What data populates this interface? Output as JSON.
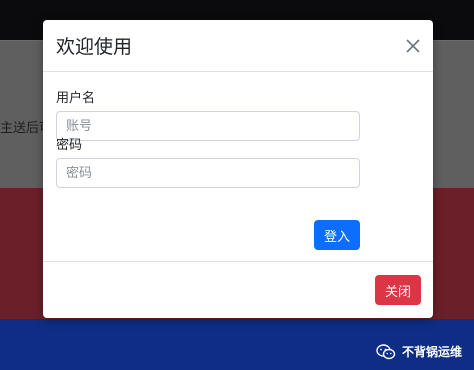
{
  "background": {
    "partial_text": "主送后可",
    "watermark_text": "不背锅运维",
    "watermark_icon": "wechat-icon"
  },
  "modal": {
    "title": "欢迎使用",
    "close_icon": "close-icon",
    "username": {
      "label": "用户名",
      "placeholder": "账号",
      "value": ""
    },
    "password": {
      "label": "密码",
      "placeholder": "密码",
      "value": ""
    },
    "login_button": "登入",
    "close_button": "关闭"
  },
  "colors": {
    "primary": "#0d6efd",
    "danger": "#dc3545",
    "overlay_red": "#6b1f29",
    "overlay_blue": "#0e2e86"
  }
}
